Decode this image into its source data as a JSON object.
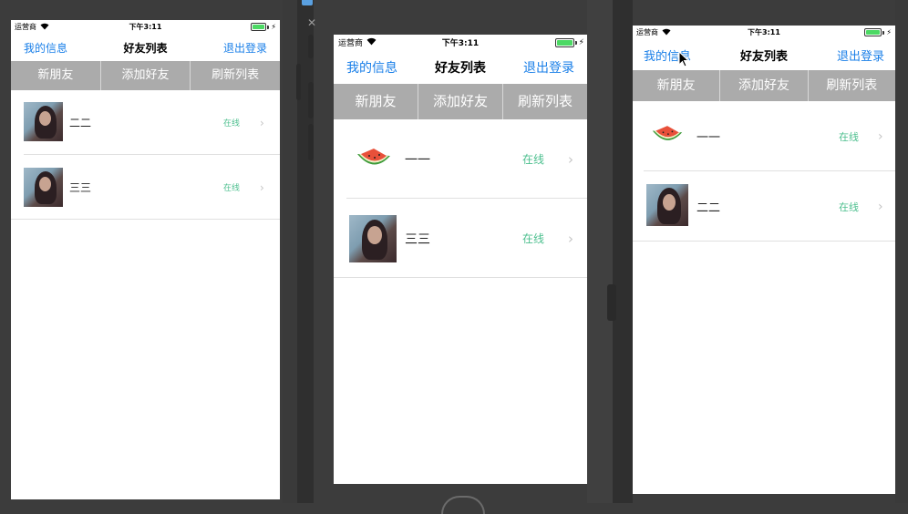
{
  "colors": {
    "accent": "#1a7fe8",
    "online": "#4cbf8e",
    "segment_bg": "#ababab"
  },
  "phones": [
    {
      "status": {
        "carrier": "运营商",
        "time": "下午3:11"
      },
      "nav": {
        "left": "我的信息",
        "title": "好友列表",
        "right": "退出登录"
      },
      "segments": [
        "新朋友",
        "添加好友",
        "刷新列表"
      ],
      "friends": [
        {
          "name": "二二",
          "status": "在线",
          "avatar": "photo-avatar"
        },
        {
          "name": "三三",
          "status": "在线",
          "avatar": "photo-avatar"
        }
      ]
    },
    {
      "status": {
        "carrier": "运营商",
        "time": "下午3:11"
      },
      "nav": {
        "left": "我的信息",
        "title": "好友列表",
        "right": "退出登录"
      },
      "segments": [
        "新朋友",
        "添加好友",
        "刷新列表"
      ],
      "friends": [
        {
          "name": "一一",
          "status": "在线",
          "avatar": "watermelon-avatar"
        },
        {
          "name": "三三",
          "status": "在线",
          "avatar": "photo-avatar"
        }
      ]
    },
    {
      "status": {
        "carrier": "运营商",
        "time": "下午3:11"
      },
      "nav": {
        "left": "我的信息",
        "title": "好友列表",
        "right": "退出登录"
      },
      "segments": [
        "新朋友",
        "添加好友",
        "刷新列表"
      ],
      "friends": [
        {
          "name": "一一",
          "status": "在线",
          "avatar": "watermelon-avatar"
        },
        {
          "name": "二二",
          "status": "在线",
          "avatar": "photo-avatar"
        }
      ]
    }
  ]
}
